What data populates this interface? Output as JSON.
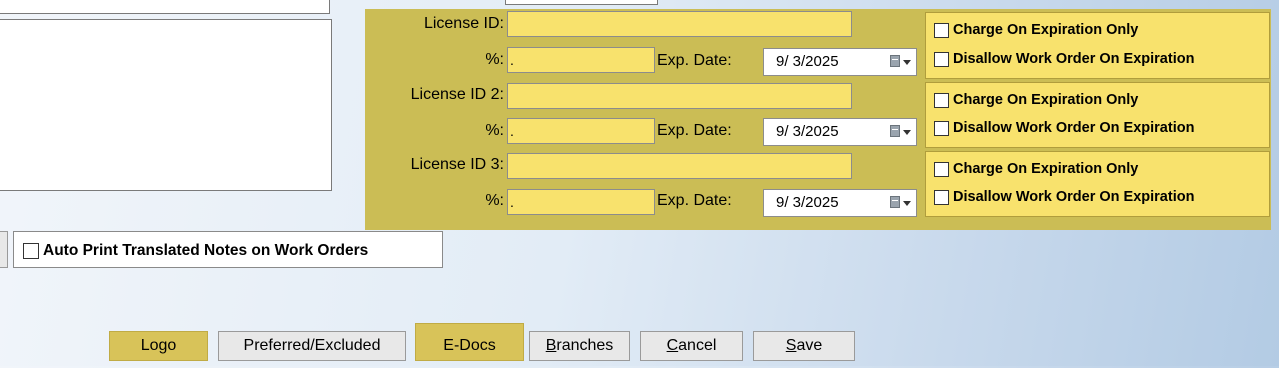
{
  "license_rows": [
    {
      "id_label": "License ID:",
      "id_value": "",
      "pct_label": "%:",
      "pct_value": ".",
      "exp_label": "Exp. Date:",
      "exp_value": "9/ 3/2025",
      "charge_label": "Charge On Expiration Only",
      "disallow_label": "Disallow Work Order On Expiration"
    },
    {
      "id_label": "License ID 2:",
      "id_value": "",
      "pct_label": "%:",
      "pct_value": ".",
      "exp_label": "Exp. Date:",
      "exp_value": "9/ 3/2025",
      "charge_label": "Charge On Expiration Only",
      "disallow_label": "Disallow Work Order On Expiration"
    },
    {
      "id_label": "License ID 3:",
      "id_value": "",
      "pct_label": "%:",
      "pct_value": ".",
      "exp_label": "Exp. Date:",
      "exp_value": "9/ 3/2025",
      "charge_label": "Charge On Expiration Only",
      "disallow_label": "Disallow Work Order On Expiration"
    }
  ],
  "auto_print": {
    "label": "Auto Print Translated Notes on Work Orders",
    "checked": false
  },
  "buttons": {
    "logo": "Logo",
    "preferred": "Preferred/Excluded",
    "edocs": "E-Docs",
    "branches": {
      "mnemonic": "B",
      "rest": "ranches"
    },
    "cancel": {
      "mnemonic": "C",
      "rest": "ancel"
    },
    "save": {
      "mnemonic": "S",
      "rest": "ave"
    }
  },
  "colors": {
    "panel": "#cbbd55",
    "field": "#f8e26d",
    "highlight_button": "#d8c359"
  }
}
